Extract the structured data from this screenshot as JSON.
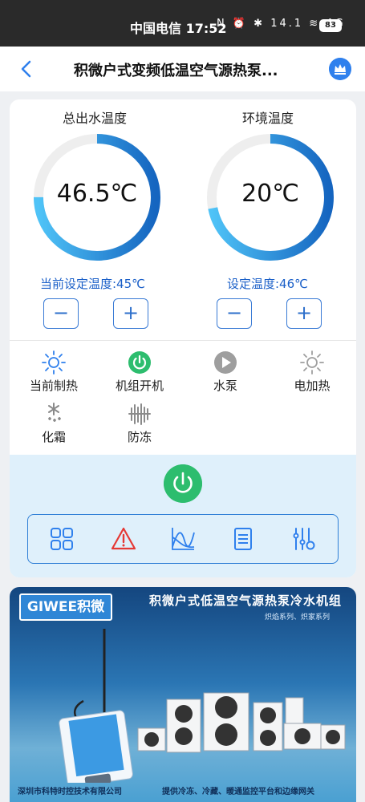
{
  "status_bar": {
    "time": "中国电信 17:52",
    "indicators": "N ⏰ ✱ 14.1 ≋ 4G",
    "battery": "83"
  },
  "header": {
    "title": "积微户式变频低温空气源热泵..."
  },
  "gauges": [
    {
      "label": "总出水温度",
      "value": "46.5℃",
      "setpoint": "当前设定温度:45℃",
      "fill": 0.75
    },
    {
      "label": "环境温度",
      "value": "20℃",
      "setpoint": "设定温度:46℃",
      "fill": 0.72
    }
  ],
  "controls": {
    "minus": "−",
    "plus": "+"
  },
  "statuses": [
    {
      "label": "当前制热",
      "icon": "sun-icon"
    },
    {
      "label": "机组开机",
      "icon": "power-on-icon"
    },
    {
      "label": "水泵",
      "icon": "play-icon"
    },
    {
      "label": "电加热",
      "icon": "heater-icon"
    },
    {
      "label": "化霜",
      "icon": "defrost-icon"
    },
    {
      "label": "防冻",
      "icon": "antifreeze-icon"
    }
  ],
  "toolbar": [
    "grid-icon",
    "alarm-icon",
    "curve-icon",
    "list-icon",
    "settings-icon"
  ],
  "banner": {
    "brand": "GIWEE积微",
    "headline": "积微户式低温空气源热泵冷水机组",
    "series": "炽焰系列、炽家系列",
    "footer_left": "深圳市科特时控技术有限公司",
    "footer_right": "提供冷冻、冷藏、暖通监控平台和边缘网关"
  },
  "colors": {
    "accent": "#2f80ed",
    "power_green": "#2dbd6e",
    "control_bg": "#dff0fb"
  }
}
